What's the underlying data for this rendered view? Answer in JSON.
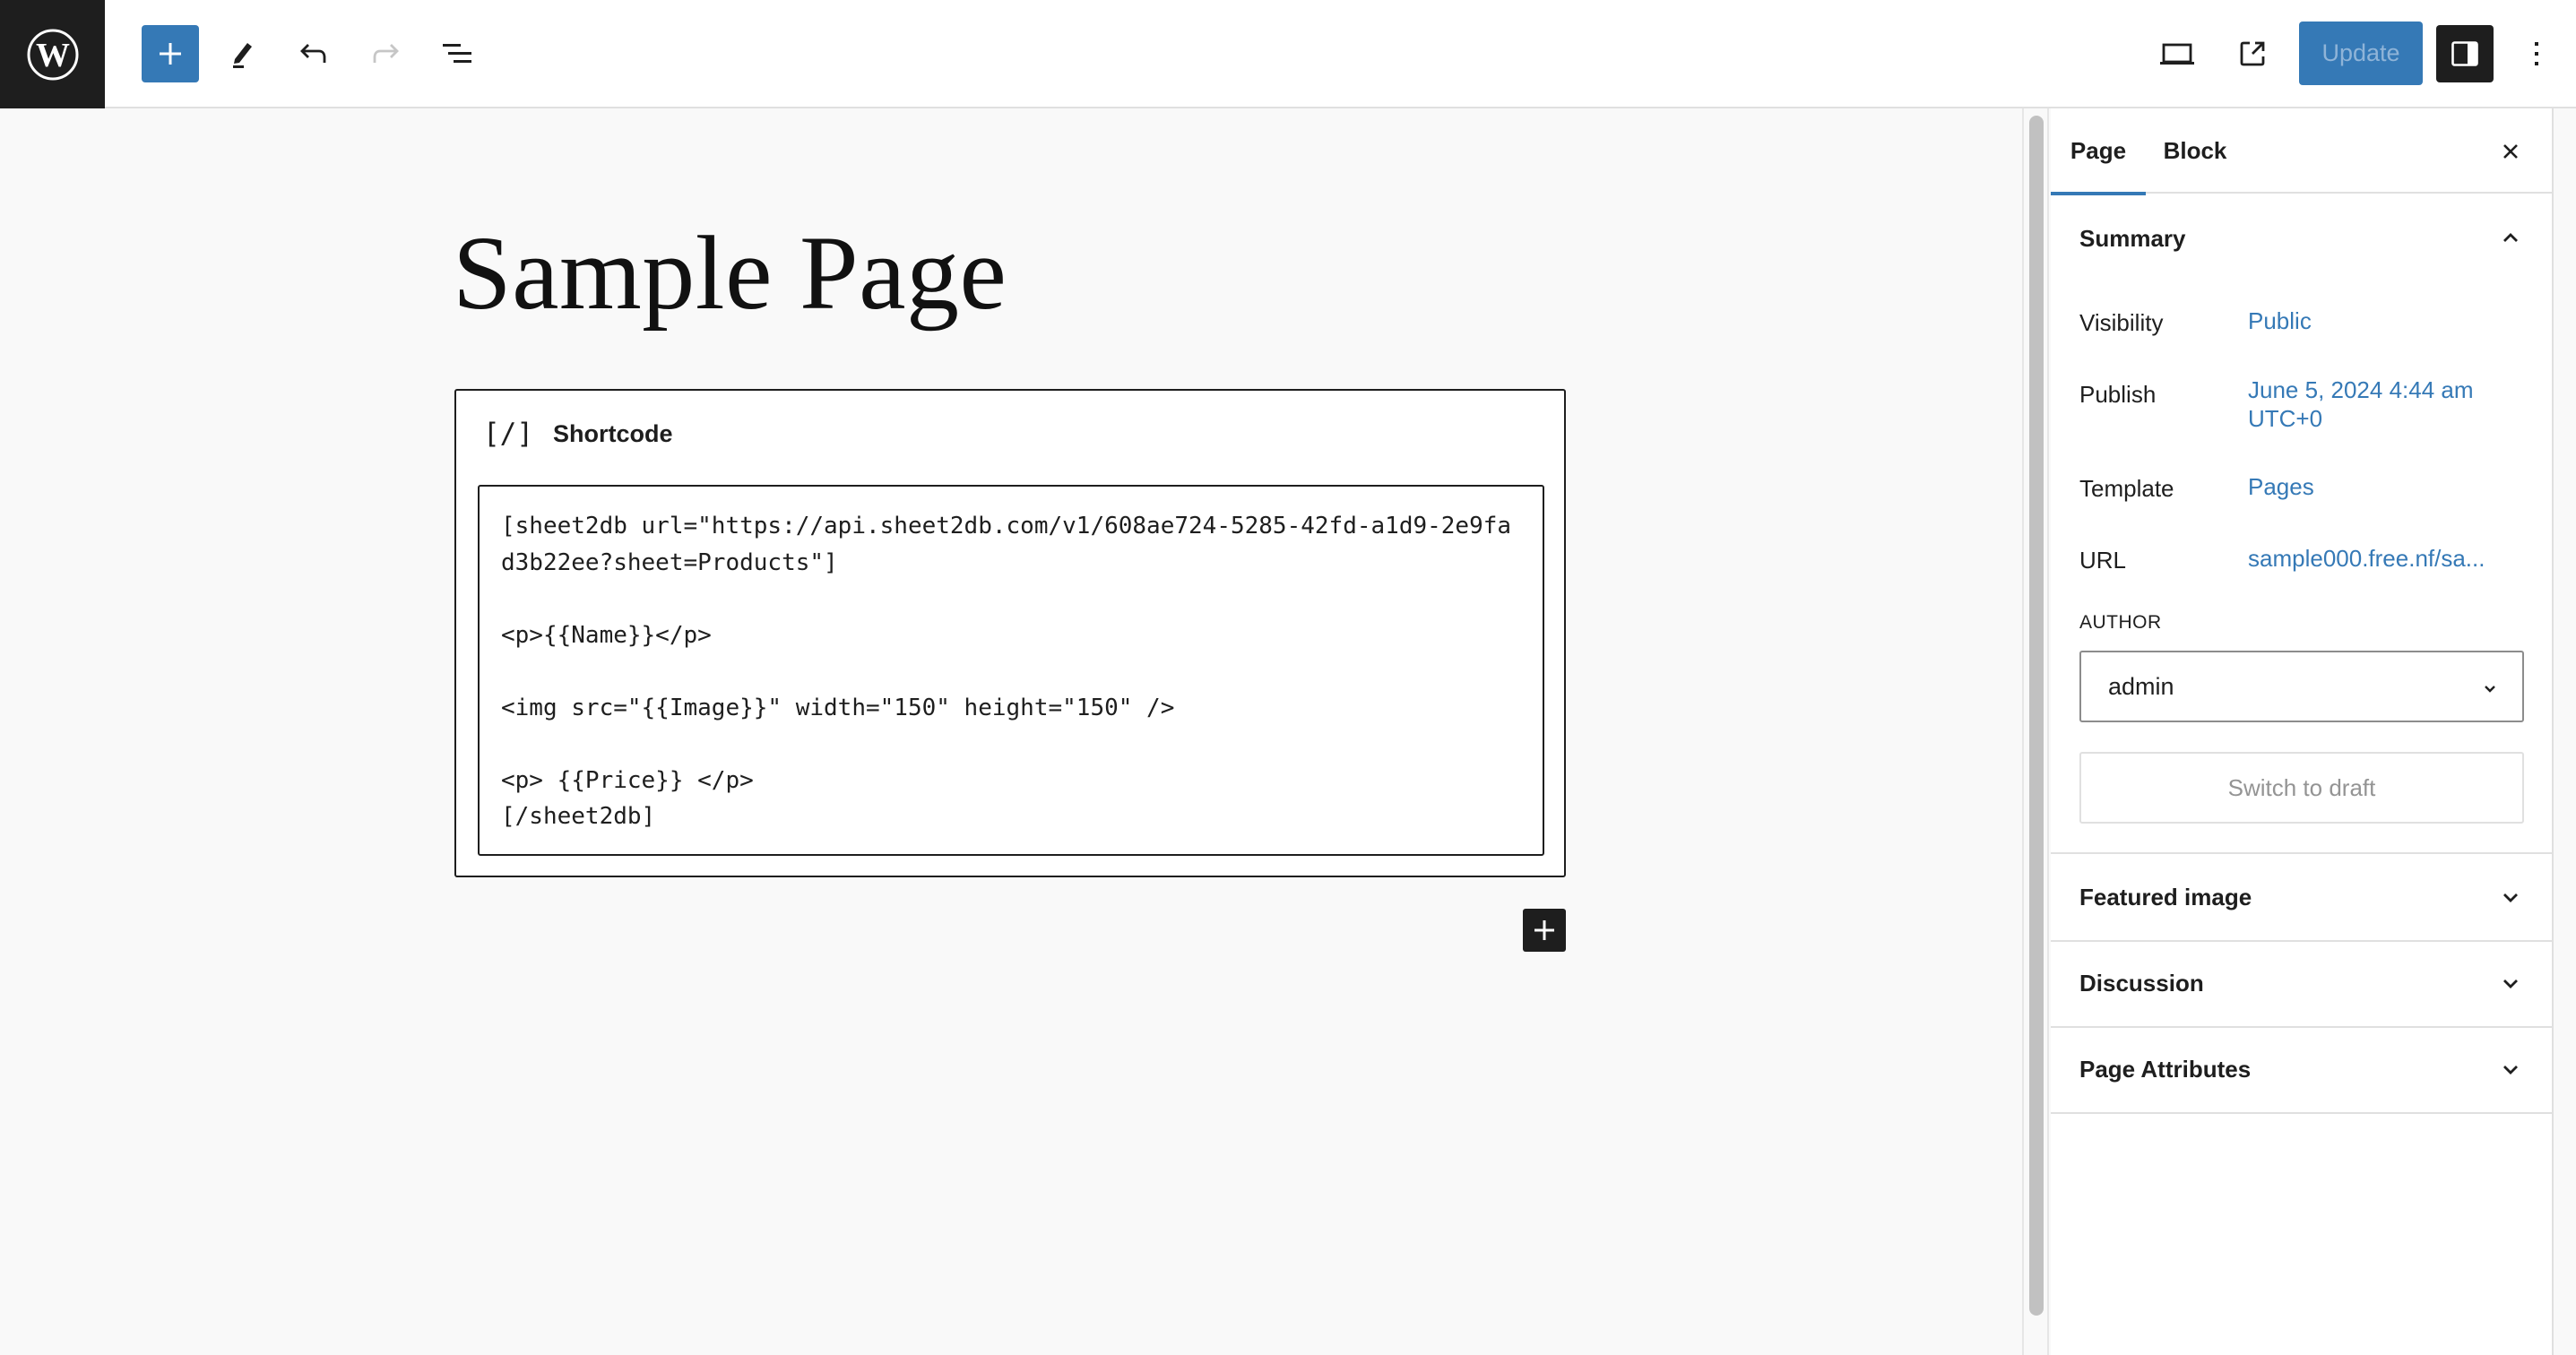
{
  "topbar": {
    "logo_icon": "wordpress-logo-icon",
    "add_block_icon": "plus-icon",
    "tools_icon": "pencil-icon",
    "undo_icon": "undo-icon",
    "redo_icon": "redo-icon",
    "list_view_icon": "list-view-icon",
    "preview_icon": "desktop-icon",
    "view_page_icon": "external-link-icon",
    "update_label": "Update",
    "settings_icon": "sidebar-toggle-icon",
    "options_icon": "more-vertical-icon",
    "colors": {
      "accent": "#3579b6",
      "dark": "#1e1e1e"
    }
  },
  "editor": {
    "page_title": "Sample Page",
    "block": {
      "icon_glyph": "[/]",
      "icon": "shortcode-icon",
      "label": "Shortcode",
      "content": "[sheet2db url=\"https://api.sheet2db.com/v1/608ae724-5285-42fd-a1d9-2e9fad3b22ee?sheet=Products\"]\n\n<p>{{Name}}</p>\n\n<img src=\"{{Image}}\" width=\"150\" height=\"150\" />\n\n<p> {{Price}} </p>\n[/sheet2db]"
    },
    "appender_icon": "plus-icon"
  },
  "sidebar": {
    "tabs": [
      {
        "label": "Page",
        "active": true
      },
      {
        "label": "Block",
        "active": false
      }
    ],
    "close_icon": "close-icon",
    "summary": {
      "title": "Summary",
      "expanded": true,
      "rows": [
        {
          "label": "Visibility",
          "value": "Public"
        },
        {
          "label": "Publish",
          "value": "June 5, 2024 4:44 am UTC+0"
        },
        {
          "label": "Template",
          "value": "Pages"
        },
        {
          "label": "URL",
          "value": "sample000.free.nf/sa..."
        }
      ],
      "author_label": "AUTHOR",
      "author_value": "admin",
      "switch_draft_label": "Switch to draft"
    },
    "panels": [
      {
        "title": "Featured image",
        "expanded": false
      },
      {
        "title": "Discussion",
        "expanded": false
      },
      {
        "title": "Page Attributes",
        "expanded": false
      }
    ]
  }
}
